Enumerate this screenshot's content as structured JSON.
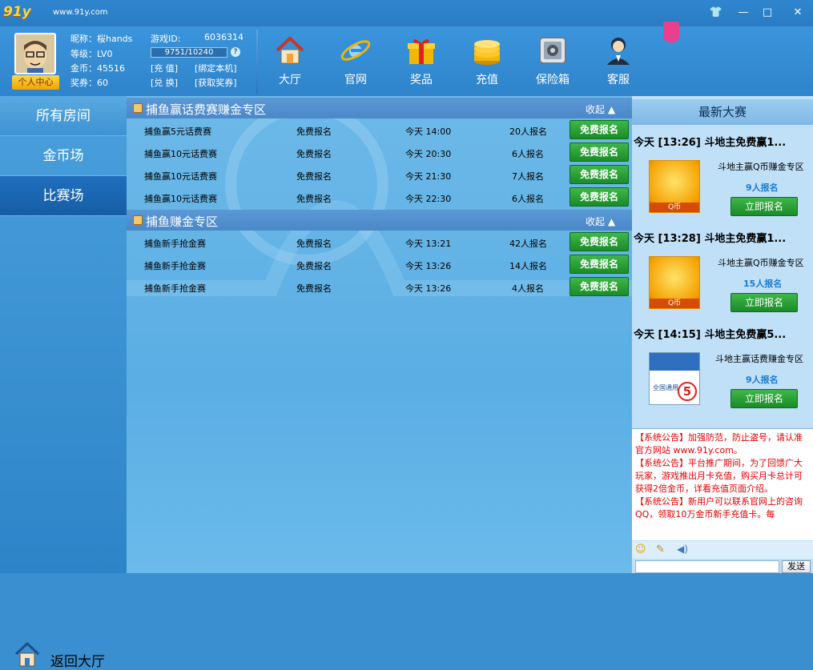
{
  "app": {
    "logo": "91y",
    "site": "www.91y.com"
  },
  "window_buttons": {
    "skin": "👕",
    "minimize": "—",
    "maximize": "□",
    "close": "✕"
  },
  "user": {
    "nickname_label": "昵称：",
    "nickname": "桜hands",
    "gameid_label": "游戏ID:",
    "gameid": "6036314",
    "level_label": "等级：",
    "level": "LV0",
    "exp": "9751/10240",
    "coins_label": "金币：",
    "coins": "45516",
    "ticket_label": "奖券：",
    "ticket": "60",
    "recharge": "[充 值]",
    "bind": "[绑定本机]",
    "exchange": "[兑 换]",
    "get_ticket": "[获取奖券]",
    "center": "个人中心"
  },
  "nav": [
    {
      "label": "大厅",
      "icon": "house-icon"
    },
    {
      "label": "官网",
      "icon": "ie-icon"
    },
    {
      "label": "奖品",
      "icon": "gift-icon"
    },
    {
      "label": "充值",
      "icon": "coins-icon"
    },
    {
      "label": "保险箱",
      "icon": "safe-icon"
    },
    {
      "label": "客服",
      "icon": "service-icon"
    }
  ],
  "sidebar": {
    "items": [
      "所有房间",
      "金币场",
      "比赛场"
    ],
    "selected": 2,
    "back": "返回大厅"
  },
  "sections": [
    {
      "title": "捕鱼赢话费赛赚金专区",
      "collapse": "收起",
      "rows": [
        {
          "name": "捕鱼赢5元话费赛",
          "fee": "免费报名",
          "time": "今天 14:00",
          "count": "20人报名",
          "btn": "免费报名"
        },
        {
          "name": "捕鱼赢10元话费赛",
          "fee": "免费报名",
          "time": "今天 20:30",
          "count": "6人报名",
          "btn": "免费报名"
        },
        {
          "name": "捕鱼赢10元话费赛",
          "fee": "免费报名",
          "time": "今天 21:30",
          "count": "7人报名",
          "btn": "免费报名"
        },
        {
          "name": "捕鱼赢10元话费赛",
          "fee": "免费报名",
          "time": "今天 22:30",
          "count": "6人报名",
          "btn": "免费报名"
        }
      ]
    },
    {
      "title": "捕鱼赚金专区",
      "collapse": "收起",
      "rows": [
        {
          "name": "捕鱼新手抢金赛",
          "fee": "免费报名",
          "time": "今天 13:21",
          "count": "42人报名",
          "btn": "免费报名"
        },
        {
          "name": "捕鱼新手抢金赛",
          "fee": "免费报名",
          "time": "今天 13:26",
          "count": "14人报名",
          "btn": "免费报名"
        },
        {
          "name": "捕鱼新手抢金赛",
          "fee": "免费报名",
          "time": "今天 13:26",
          "count": "4人报名",
          "btn": "免费报名"
        }
      ]
    }
  ],
  "right": {
    "header": "最新大赛",
    "matches": [
      {
        "title": "今天 [13:26] 斗地主免费赢1...",
        "name": "斗地主赢Q币赚金专区",
        "count": "9人报名",
        "btn": "立即报名",
        "img_label": "Q币"
      },
      {
        "title": "今天 [13:28] 斗地主免费赢1...",
        "name": "斗地主赢Q币赚金专区",
        "count": "15人报名",
        "btn": "立即报名",
        "img_label": "Q币"
      },
      {
        "title": "今天 [14:15] 斗地主免费赢5...",
        "name": "斗地主赢话费赚金专区",
        "count": "9人报名",
        "btn": "立即报名",
        "img_label": "全国通用",
        "img_num": "5"
      }
    ],
    "notice": [
      "【系统公告】加强防范，防止盗号，请认准官方网站 www.91y.com。",
      "【系统公告】平台推广期间，为了回馈广大玩家，游戏推出月卡充值，购买月卡总计可获得2倍金币，详看充值页面介绍。",
      "【系统公告】新用户可以联系官网上的咨询QQ，领取10万金币新手充值卡。每"
    ],
    "send": "发送"
  }
}
